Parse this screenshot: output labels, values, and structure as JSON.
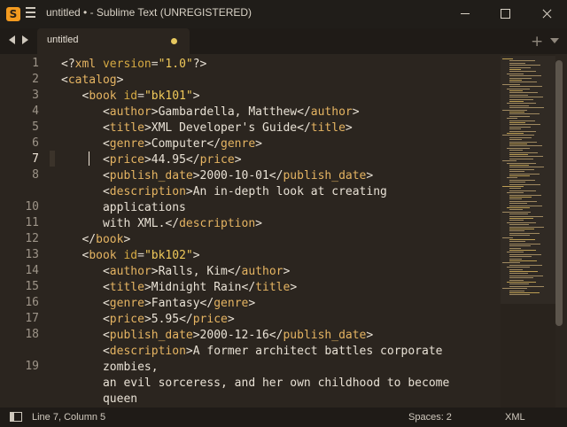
{
  "window": {
    "title": "untitled • - Sublime Text (UNREGISTERED)",
    "icon": "sublime-logo"
  },
  "tabs": {
    "items": [
      {
        "label": "untitled",
        "modified": true
      }
    ]
  },
  "editor": {
    "line_numbers": [
      "1",
      "2",
      "3",
      "4",
      "5",
      "6",
      "7",
      "8",
      "",
      "10",
      "11",
      "12",
      "13",
      "14",
      "15",
      "16",
      "17",
      "18",
      "",
      "19",
      ""
    ],
    "lines": [
      {
        "segments": [
          {
            "t": "<?",
            "c": "br"
          },
          {
            "t": "xml",
            "c": "tag"
          },
          {
            "t": " ",
            "c": ""
          },
          {
            "t": "version",
            "c": "attr"
          },
          {
            "t": "=",
            "c": ""
          },
          {
            "t": "\"1.0\"",
            "c": "str"
          },
          {
            "t": "?>",
            "c": "br"
          }
        ]
      },
      {
        "segments": [
          {
            "t": "<",
            "c": "br"
          },
          {
            "t": "catalog",
            "c": "tag"
          },
          {
            "t": ">",
            "c": "br"
          }
        ]
      },
      {
        "segments": [
          {
            "t": "   <",
            "c": "br"
          },
          {
            "t": "book",
            "c": "tag"
          },
          {
            "t": " ",
            "c": ""
          },
          {
            "t": "id",
            "c": "attr"
          },
          {
            "t": "=",
            "c": ""
          },
          {
            "t": "\"bk101\"",
            "c": "str"
          },
          {
            "t": ">",
            "c": "br"
          }
        ]
      },
      {
        "segments": [
          {
            "t": "      <",
            "c": "br"
          },
          {
            "t": "author",
            "c": "tag"
          },
          {
            "t": ">Gambardella, Matthew</",
            "c": "br"
          },
          {
            "t": "author",
            "c": "tag"
          },
          {
            "t": ">",
            "c": "br"
          }
        ]
      },
      {
        "segments": [
          {
            "t": "      <",
            "c": "br"
          },
          {
            "t": "title",
            "c": "tag"
          },
          {
            "t": ">XML Developer's Guide</",
            "c": "br"
          },
          {
            "t": "title",
            "c": "tag"
          },
          {
            "t": ">",
            "c": "br"
          }
        ]
      },
      {
        "segments": [
          {
            "t": "      <",
            "c": "br"
          },
          {
            "t": "genre",
            "c": "tag"
          },
          {
            "t": ">Computer</",
            "c": "br"
          },
          {
            "t": "genre",
            "c": "tag"
          },
          {
            "t": ">",
            "c": "br"
          }
        ]
      },
      {
        "segments": [
          {
            "t": "      <",
            "c": "br"
          },
          {
            "t": "price",
            "c": "tag"
          },
          {
            "t": ">44.95</",
            "c": "br"
          },
          {
            "t": "price",
            "c": "tag"
          },
          {
            "t": ">",
            "c": "br"
          }
        ]
      },
      {
        "segments": [
          {
            "t": "      <",
            "c": "br"
          },
          {
            "t": "publish_date",
            "c": "tag"
          },
          {
            "t": ">2000-10-01</",
            "c": "br"
          },
          {
            "t": "publish_date",
            "c": "tag"
          },
          {
            "t": ">",
            "c": "br"
          }
        ]
      },
      {
        "segments": [
          {
            "t": "      <",
            "c": "br"
          },
          {
            "t": "description",
            "c": "tag"
          },
          {
            "t": ">An in-depth look at creating",
            "c": "br"
          }
        ]
      },
      {
        "segments": [
          {
            "t": "      applications",
            "c": "br"
          }
        ]
      },
      {
        "segments": [
          {
            "t": "      with XML.</",
            "c": "br"
          },
          {
            "t": "description",
            "c": "tag"
          },
          {
            "t": ">",
            "c": "br"
          }
        ]
      },
      {
        "segments": [
          {
            "t": "   </",
            "c": "br"
          },
          {
            "t": "book",
            "c": "tag"
          },
          {
            "t": ">",
            "c": "br"
          }
        ]
      },
      {
        "segments": [
          {
            "t": "   <",
            "c": "br"
          },
          {
            "t": "book",
            "c": "tag"
          },
          {
            "t": " ",
            "c": ""
          },
          {
            "t": "id",
            "c": "attr"
          },
          {
            "t": "=",
            "c": ""
          },
          {
            "t": "\"bk102\"",
            "c": "str"
          },
          {
            "t": ">",
            "c": "br"
          }
        ]
      },
      {
        "segments": [
          {
            "t": "      <",
            "c": "br"
          },
          {
            "t": "author",
            "c": "tag"
          },
          {
            "t": ">Ralls, Kim</",
            "c": "br"
          },
          {
            "t": "author",
            "c": "tag"
          },
          {
            "t": ">",
            "c": "br"
          }
        ]
      },
      {
        "segments": [
          {
            "t": "      <",
            "c": "br"
          },
          {
            "t": "title",
            "c": "tag"
          },
          {
            "t": ">Midnight Rain</",
            "c": "br"
          },
          {
            "t": "title",
            "c": "tag"
          },
          {
            "t": ">",
            "c": "br"
          }
        ]
      },
      {
        "segments": [
          {
            "t": "      <",
            "c": "br"
          },
          {
            "t": "genre",
            "c": "tag"
          },
          {
            "t": ">Fantasy</",
            "c": "br"
          },
          {
            "t": "genre",
            "c": "tag"
          },
          {
            "t": ">",
            "c": "br"
          }
        ]
      },
      {
        "segments": [
          {
            "t": "      <",
            "c": "br"
          },
          {
            "t": "price",
            "c": "tag"
          },
          {
            "t": ">5.95</",
            "c": "br"
          },
          {
            "t": "price",
            "c": "tag"
          },
          {
            "t": ">",
            "c": "br"
          }
        ]
      },
      {
        "segments": [
          {
            "t": "      <",
            "c": "br"
          },
          {
            "t": "publish_date",
            "c": "tag"
          },
          {
            "t": ">2000-12-16</",
            "c": "br"
          },
          {
            "t": "publish_date",
            "c": "tag"
          },
          {
            "t": ">",
            "c": "br"
          }
        ]
      },
      {
        "segments": [
          {
            "t": "      <",
            "c": "br"
          },
          {
            "t": "description",
            "c": "tag"
          },
          {
            "t": ">A former architect battles corporate",
            "c": "br"
          }
        ]
      },
      {
        "segments": [
          {
            "t": "      zombies,",
            "c": "br"
          }
        ]
      },
      {
        "segments": [
          {
            "t": "      an evil sorceress, and her own childhood to become",
            "c": "br"
          }
        ]
      },
      {
        "segments": [
          {
            "t": "      queen",
            "c": "br"
          }
        ]
      }
    ],
    "active_line": "7"
  },
  "status": {
    "position": "Line 7, Column 5",
    "spaces": "Spaces: 2",
    "syntax": "XML"
  },
  "icons": [
    "menu-icon",
    "back-arrow-icon",
    "forward-arrow-icon",
    "plus-icon",
    "chevron-down-icon",
    "panel-toggle-icon"
  ],
  "colors": {
    "background": "#2b251f",
    "tag": "#e5b462",
    "attribute": "#d6aa43",
    "string": "#f0c95a"
  }
}
